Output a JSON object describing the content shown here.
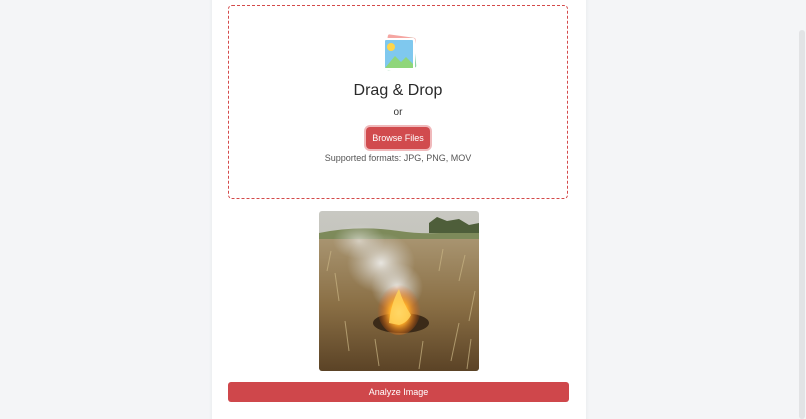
{
  "upload": {
    "icon": "image-icon",
    "title": "Drag & Drop",
    "or": "or",
    "browse_label": "Browse Files",
    "formats": "Supported formats: JPG, PNG, MOV"
  },
  "preview": {
    "description_icon": "image-preview"
  },
  "actions": {
    "analyze_label": "Analyze Image"
  },
  "colors": {
    "accent": "#d14b4e",
    "dash_border": "#d44a4a",
    "background": "#f4f5f7"
  }
}
